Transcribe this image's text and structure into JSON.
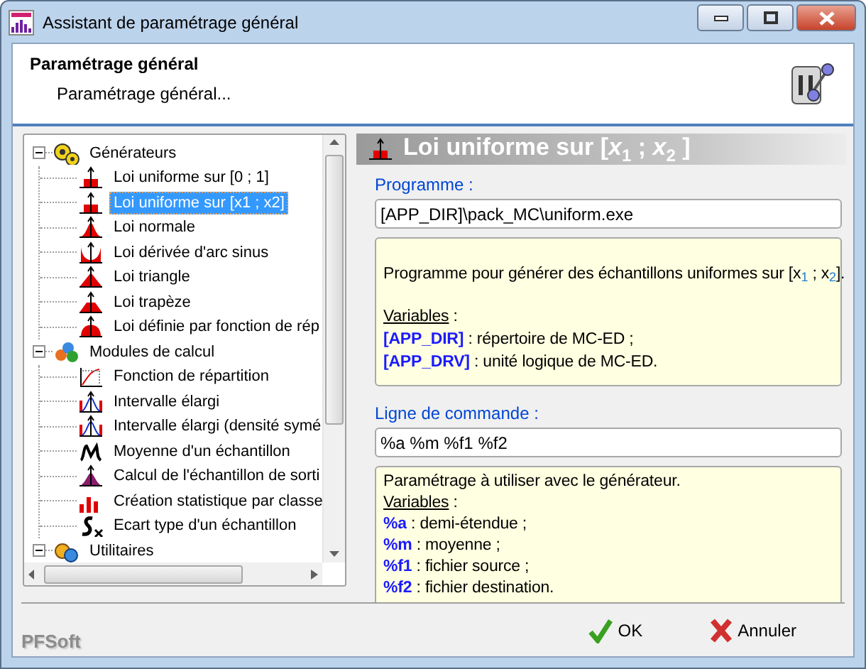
{
  "window": {
    "title": "Assistant de paramétrage général"
  },
  "header": {
    "title": "Paramétrage général",
    "subtitle": "Paramétrage général..."
  },
  "tree": [
    {
      "label": "Générateurs",
      "kind": "generators",
      "expanded": true,
      "selected": false,
      "children": [
        {
          "label": "Loi uniforme sur [0 ; 1]",
          "kind": "uniform",
          "selected": false
        },
        {
          "label": "Loi uniforme sur [x1 ; x2]",
          "kind": "uniform",
          "selected": true
        },
        {
          "label": "Loi normale",
          "kind": "normal",
          "selected": false
        },
        {
          "label": "Loi dérivée d'arc sinus",
          "kind": "arcsine",
          "selected": false
        },
        {
          "label": "Loi triangle",
          "kind": "triangle",
          "selected": false
        },
        {
          "label": "Loi trapèze",
          "kind": "trapeze",
          "selected": false
        },
        {
          "label": "Loi définie par fonction de rép",
          "kind": "custom",
          "selected": false
        }
      ]
    },
    {
      "label": "Modules de calcul",
      "kind": "modules",
      "expanded": true,
      "selected": false,
      "children": [
        {
          "label": "Fonction de répartition",
          "kind": "cdf",
          "selected": false
        },
        {
          "label": "Intervalle élargi",
          "kind": "interval",
          "selected": false
        },
        {
          "label": "Intervalle élargi (densité symé",
          "kind": "interval",
          "selected": false
        },
        {
          "label": "Moyenne d'un échantillon",
          "kind": "mean",
          "selected": false
        },
        {
          "label": "Calcul de l'échantillon de sorti",
          "kind": "sample",
          "selected": false
        },
        {
          "label": "Création statistique par classe",
          "kind": "histogram",
          "selected": false
        },
        {
          "label": "Ecart type d'un échantillon",
          "kind": "stdev",
          "selected": false
        }
      ]
    },
    {
      "label": "Utilitaires",
      "kind": "utilities",
      "expanded": true,
      "selected": false
    }
  ],
  "detail": {
    "title": "Loi uniforme sur [*x*$_{1}$ ; *x*$_{2}$ ]",
    "program_label": "Programme :",
    "program": "[APP_DIR]\\pack_MC\\uniform.exe",
    "program_note": {
      "intro": "Programme pour générer des échantillons uniformes sur [x$_{1}$ ; x$_{2}$].",
      "heading": "Variables",
      "heading_suffix": " :",
      "variables": [
        "**[APP_DIR]** : répertoire de MC-ED ;",
        "**[APP_DRV]** : unité logique de MC-ED."
      ]
    },
    "command_label": "Ligne de commande :",
    "command": "%a %m %f1 %f2",
    "command_note": {
      "intro": "Paramétrage à utiliser avec le générateur.",
      "heading": "Variables",
      "heading_suffix": " :",
      "variables": [
        "**%a** : demi-étendue ;",
        "**%m** : moyenne ;",
        "**%f1** : fichier source ;",
        "**%f2** : fichier destination."
      ]
    }
  },
  "footer": {
    "brand": "PFSoft",
    "buttons": [
      {
        "label": "OK",
        "kind": "ok"
      },
      {
        "label": "Annuler",
        "kind": "cancel"
      }
    ]
  }
}
